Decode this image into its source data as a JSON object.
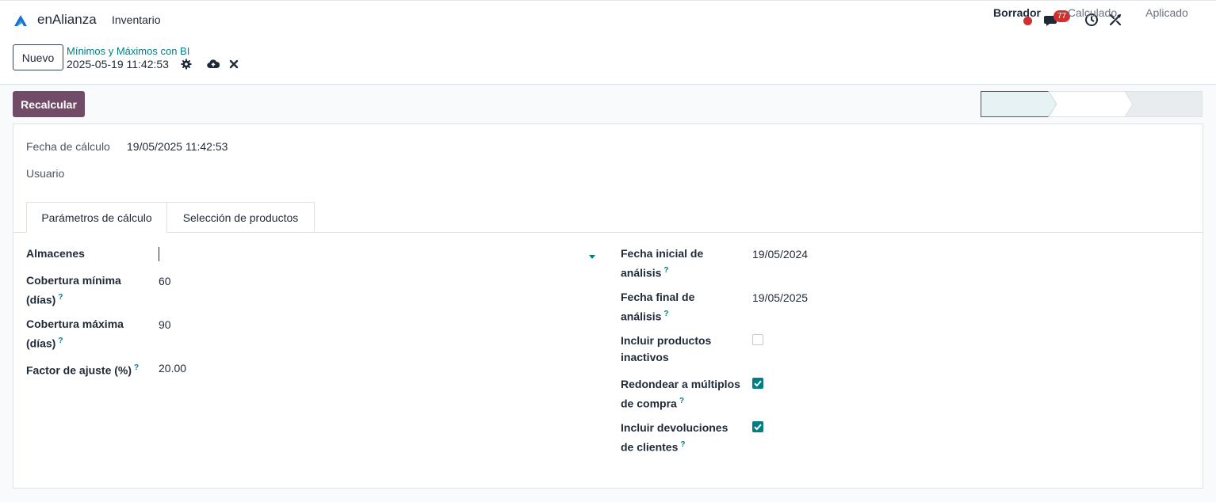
{
  "header": {
    "brand": "enAlianza",
    "app_menu": "Inventario",
    "chat_badge": "77"
  },
  "control": {
    "new_label": "Nuevo",
    "breadcrumb_parent": "Mínimos y Máximos con BI",
    "breadcrumb_current": "2025-05-19 11:42:53"
  },
  "actions": {
    "recalculate_label": "Recalcular"
  },
  "statusbar": {
    "steps": [
      "Borrador",
      "Calculado",
      "Aplicado"
    ],
    "active": "Borrador"
  },
  "form": {
    "calc_date_label": "Fecha de cálculo",
    "calc_date_value": "19/05/2025 11:42:53",
    "user_label": "Usuario",
    "user_value": ""
  },
  "tabs": [
    {
      "label": "Parámetros de cálculo",
      "active": true
    },
    {
      "label": "Selección de productos",
      "active": false
    }
  ],
  "params": {
    "warehouses_label": "Almacenes",
    "warehouses_value": "",
    "min_cov_label_1": "Cobertura mínima",
    "min_cov_label_2": "(días)",
    "min_cov_value": "60",
    "max_cov_label_1": "Cobertura máxima",
    "max_cov_label_2": "(días)",
    "max_cov_value": "90",
    "adj_factor_label": "Factor de ajuste (%)",
    "adj_factor_value": "20.00",
    "start_date_label_1": "Fecha inicial de",
    "start_date_label_2": "análisis",
    "start_date_value": "19/05/2024",
    "end_date_label_1": "Fecha final de",
    "end_date_label_2": "análisis",
    "end_date_value": "19/05/2025",
    "inactive_label_1": "Incluir productos",
    "inactive_label_2": "inactivos",
    "inactive_checked": false,
    "round_label_1": "Redondear a múltiplos",
    "round_label_2": "de compra",
    "round_checked": true,
    "returns_label_1": "Incluir devoluciones",
    "returns_label_2": "de clientes",
    "returns_checked": true,
    "help_mark": "?"
  },
  "colors": {
    "primary": "#714b67",
    "accent": "#017e84",
    "danger": "#d32f2f"
  }
}
